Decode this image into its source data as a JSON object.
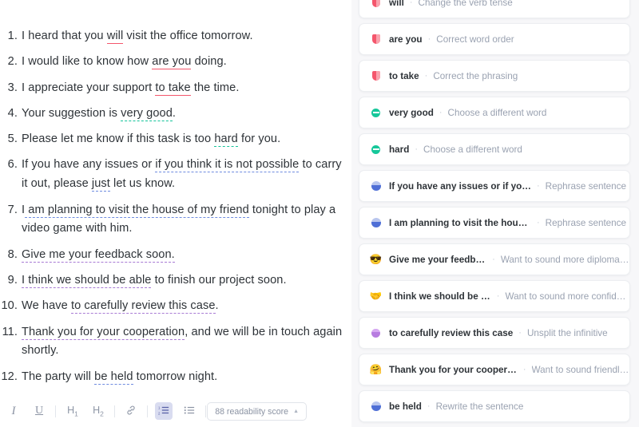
{
  "editor": {
    "items": [
      {
        "num": "1.",
        "parts": [
          {
            "t": "I heard that you ",
            "u": "none"
          },
          {
            "t": "will",
            "u": "red"
          },
          {
            "t": " visit the office tomorrow.",
            "u": "none"
          }
        ]
      },
      {
        "num": "2.",
        "parts": [
          {
            "t": "I would like to know how ",
            "u": "none"
          },
          {
            "t": "are you",
            "u": "red"
          },
          {
            "t": " doing.",
            "u": "none"
          }
        ]
      },
      {
        "num": "3.",
        "parts": [
          {
            "t": "I appreciate your support ",
            "u": "none"
          },
          {
            "t": "to take",
            "u": "red"
          },
          {
            "t": " the time.",
            "u": "none"
          }
        ]
      },
      {
        "num": "4.",
        "parts": [
          {
            "t": "Your suggestion is ",
            "u": "none"
          },
          {
            "t": "very good",
            "u": "green"
          },
          {
            "t": ".",
            "u": "none"
          }
        ]
      },
      {
        "num": "5.",
        "parts": [
          {
            "t": "Please let me know if this task is too ",
            "u": "none"
          },
          {
            "t": "hard",
            "u": "green"
          },
          {
            "t": " for you.",
            "u": "none"
          }
        ]
      },
      {
        "num": "6.",
        "parts": [
          {
            "t": "If you have any issues or ",
            "u": "none"
          },
          {
            "t": "if you think it is not possible",
            "u": "blue"
          },
          {
            "t": " to carry it out, please ",
            "u": "none"
          },
          {
            "t": "just",
            "u": "blue"
          },
          {
            "t": " let us know.",
            "u": "none"
          }
        ]
      },
      {
        "num": "7.",
        "parts": [
          {
            "t": "I",
            "u": "none"
          },
          {
            "t": " am planning to visit the house of my friend",
            "u": "blue"
          },
          {
            "t": " tonight to play a video game with him.",
            "u": "none"
          }
        ]
      },
      {
        "num": "8.",
        "parts": [
          {
            "t": "Give me your feedback soon.",
            "u": "purple"
          }
        ]
      },
      {
        "num": "9.",
        "parts": [
          {
            "t": "I think we should be able",
            "u": "purple"
          },
          {
            "t": " to finish our project soon.",
            "u": "none"
          }
        ]
      },
      {
        "num": "10.",
        "parts": [
          {
            "t": "We have ",
            "u": "none"
          },
          {
            "t": "to carefully review this case",
            "u": "purple"
          },
          {
            "t": ".",
            "u": "none"
          }
        ]
      },
      {
        "num": "11.",
        "parts": [
          {
            "t": "Thank you for your cooperation",
            "u": "purple"
          },
          {
            "t": ", and we will be in touch again shortly.",
            "u": "none"
          }
        ]
      },
      {
        "num": "12.",
        "parts": [
          {
            "t": "The party will ",
            "u": "none"
          },
          {
            "t": "be held",
            "u": "blue"
          },
          {
            "t": " tomorrow night.",
            "u": "none"
          }
        ]
      }
    ]
  },
  "toolbar": {
    "italic_label": "I",
    "underline_label": "U",
    "h1_label": "H",
    "h1_sub": "1",
    "h2_label": "H",
    "h2_sub": "2",
    "link_icon": "link-icon",
    "ordered_list_icon": "ordered-list-icon",
    "bullet_list_icon": "bullet-list-icon",
    "clear_format_icon": "clear-formatting-icon",
    "readability_label": "88 readability score",
    "readability_caret": "▲"
  },
  "suggestions": {
    "cards": [
      {
        "icon": "shield-red-icon",
        "fragment": "will",
        "action": "Change the verb tense",
        "accent": "#f4566c"
      },
      {
        "icon": "shield-red-icon",
        "fragment": "are you",
        "action": "Correct word order",
        "accent": "#f4566c"
      },
      {
        "icon": "shield-red-icon",
        "fragment": "to take",
        "action": "Correct the phrasing",
        "accent": "#f4566c"
      },
      {
        "icon": "sync-green-icon",
        "fragment": "very good",
        "action": "Choose a different word",
        "accent": "#16c79a"
      },
      {
        "icon": "sync-green-icon",
        "fragment": "hard",
        "action": "Choose a different word",
        "accent": "#16c79a"
      },
      {
        "icon": "bubble-blue-icon",
        "fragment": "If you have any issues or if you thi…",
        "action": "Rephrase sentence",
        "accent": "#4f6fd6"
      },
      {
        "icon": "bubble-blue-icon",
        "fragment": "I am planning to visit the house of…",
        "action": "Rephrase sentence",
        "accent": "#4f6fd6"
      },
      {
        "icon": "sunglasses-emoji-icon",
        "emoji": "😎",
        "fragment": "Give me your feedba…",
        "action": "Want to sound more diplomatic?",
        "accent": "#a87bd4"
      },
      {
        "icon": "handshake-emoji-icon",
        "emoji": "🤝",
        "fragment": "I think we should be a…",
        "action": "Want to sound more confident?",
        "accent": "#a87bd4"
      },
      {
        "icon": "circle-purple-icon",
        "fragment": "to carefully review this case",
        "action": "Unsplit the infinitive",
        "accent": "#b77ce0"
      },
      {
        "icon": "hugging-emoji-icon",
        "emoji": "🤗",
        "fragment": "Thank you for your cooperat…",
        "action": "Want to sound friendlier?",
        "accent": "#a87bd4"
      },
      {
        "icon": "bubble-blue-icon",
        "fragment": "be held",
        "action": "Rewrite the sentence",
        "accent": "#4f6fd6"
      }
    ]
  }
}
